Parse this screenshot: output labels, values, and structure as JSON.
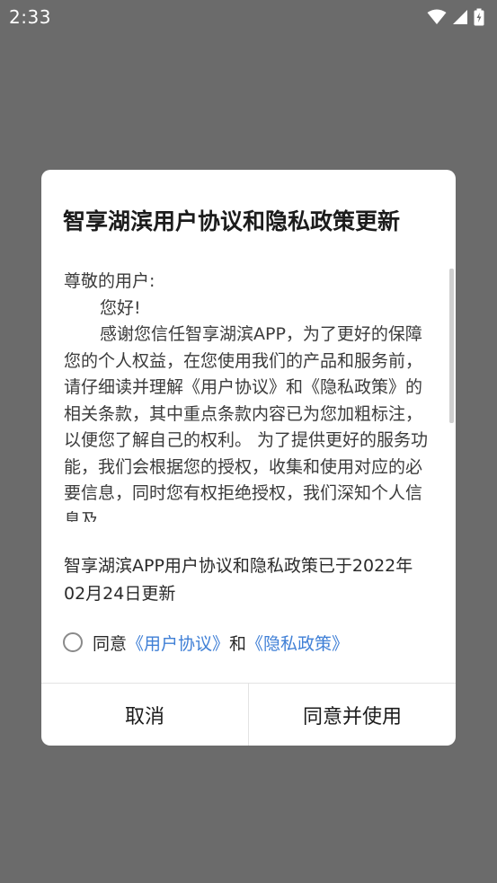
{
  "status_bar": {
    "time": "2:33",
    "icons": [
      "wifi-icon",
      "signal-icon",
      "battery-icon"
    ]
  },
  "dialog": {
    "title": "智享湖滨用户协议和隐私政策更新",
    "greeting": "尊敬的用户:",
    "hello": "您好!",
    "body": "感谢您信任智享湖滨APP，为了更好的保障您的个人权益，在您使用我们的产品和服务前，请仔细读并理解《用户协议》和《隐私政策》的相关条款，其中重点条款内容已为您加粗标注，以便您了解自己的权利。 为了提供更好的服务功能，我们会根据您的授权，收集和使用对应的必要信息，同时您有权拒绝授权，我们深知个人信息及",
    "update_notice": "智享湖滨APP用户协议和隐私政策已于2022年02月24日更新",
    "agree_prefix": "同意",
    "user_agreement_link": "《用户协议》",
    "and_text": "和",
    "privacy_policy_link": "《隐私政策》",
    "cancel_label": "取消",
    "accept_label": "同意并使用"
  },
  "colors": {
    "overlay": "#6b6b6b",
    "link": "#3f7fd6",
    "dialog_bg": "#ffffff"
  }
}
